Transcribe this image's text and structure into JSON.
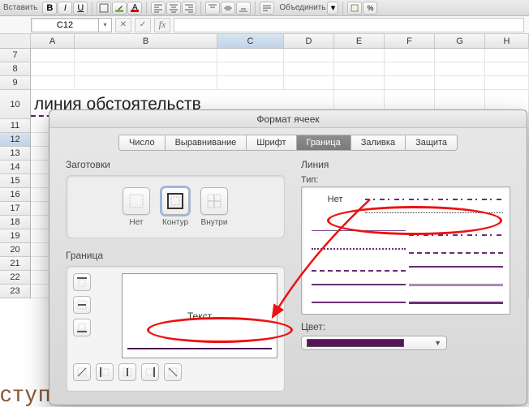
{
  "toolbar": {
    "paste_label": "Вставить",
    "merge_label": "Объединить"
  },
  "formula_bar": {
    "name_box": "C12",
    "fx": "fx"
  },
  "sheet": {
    "columns": [
      "A",
      "B",
      "C",
      "D",
      "E",
      "F",
      "G",
      "H"
    ],
    "row_start": 7,
    "row_end": 23,
    "tall_row": 10,
    "active_row": 12,
    "active_col": "C",
    "cell_text": "линия обстоятельств"
  },
  "cropped_text": "ступ",
  "dialog": {
    "title": "Формат ячеек",
    "tabs": [
      "Число",
      "Выравнивание",
      "Шрифт",
      "Граница",
      "Заливка",
      "Защита"
    ],
    "active_tab": 3,
    "presets_label": "Заготовки",
    "presets": [
      {
        "label": "Нет",
        "selected": false
      },
      {
        "label": "Контур",
        "selected": true
      },
      {
        "label": "Внутри",
        "selected": false
      }
    ],
    "border_label": "Граница",
    "preview_text": "Текст",
    "line_section": "Линия",
    "line_type": "Тип:",
    "line_none": "Нет",
    "color_label": "Цвет:",
    "color_value": "#59135e"
  }
}
